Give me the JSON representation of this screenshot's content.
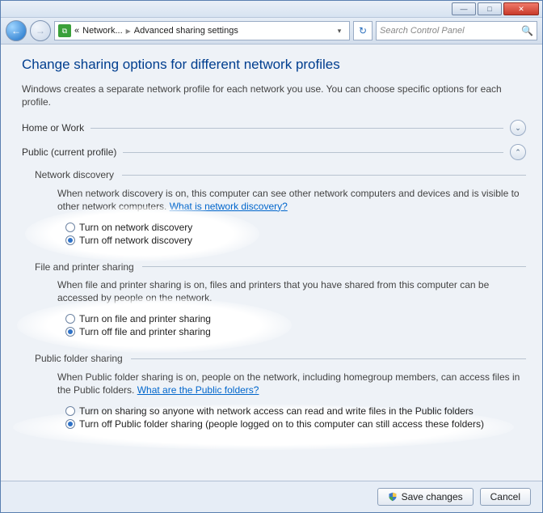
{
  "titlebar": {
    "minimize": "—",
    "maximize": "□",
    "close": "✕"
  },
  "nav": {
    "path_item1": "Network...",
    "path_item2": "Advanced sharing settings",
    "search_placeholder": "Search Control Panel"
  },
  "page": {
    "heading": "Change sharing options for different network profiles",
    "intro": "Windows creates a separate network profile for each network you use. You can choose specific options for each profile."
  },
  "profiles": {
    "home": "Home or Work",
    "public": "Public (current profile)"
  },
  "sections": {
    "netdisc": {
      "title": "Network discovery",
      "desc_a": "When network discovery is on, this computer can see other network computers and devices and is visible to other network computers. ",
      "help": "What is network discovery?",
      "opt_on": "Turn on network discovery",
      "opt_off": "Turn off network discovery"
    },
    "fps": {
      "title": "File and printer sharing",
      "desc": "When file and printer sharing is on, files and printers that you have shared from this computer can be accessed by people on the network.",
      "opt_on": "Turn on file and printer sharing",
      "opt_off": "Turn off file and printer sharing"
    },
    "pfs": {
      "title": "Public folder sharing",
      "desc_a": "When Public folder sharing is on, people on the network, including homegroup members, can access files in the Public folders. ",
      "help": "What are the Public folders?",
      "opt_on": "Turn on sharing so anyone with network access can read and write files in the Public folders",
      "opt_off": "Turn off Public folder sharing (people logged on to this computer can still access these folders)"
    }
  },
  "footer": {
    "save": "Save changes",
    "cancel": "Cancel"
  }
}
